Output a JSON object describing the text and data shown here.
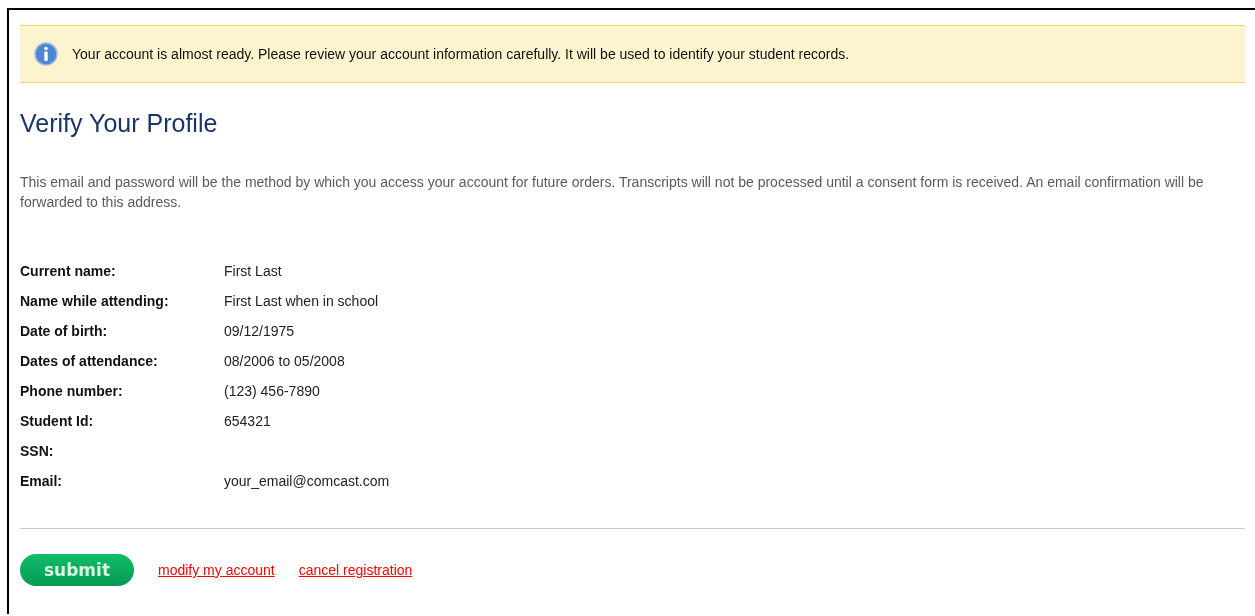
{
  "notice": {
    "text": "Your account is almost ready. Please review your account information carefully. It will be used to identify your student records."
  },
  "title": "Verify Your Profile",
  "description": "This email and password will be the method by which you access your account for future orders. Transcripts will not be processed until a consent form is received. An email confirmation will be forwarded to this address.",
  "fields": [
    {
      "label": "Current name:",
      "value": "First Last"
    },
    {
      "label": "Name while attending:",
      "value": "First Last when in school"
    },
    {
      "label": "Date of birth:",
      "value": "09/12/1975"
    },
    {
      "label": "Dates of attendance:",
      "value": "08/2006 to 05/2008"
    },
    {
      "label": "Phone number:",
      "value": "(123) 456-7890"
    },
    {
      "label": "Student Id:",
      "value": "654321"
    },
    {
      "label": "SSN:"
    },
    {
      "label": "Email:",
      "value": "your_email@comcast.com"
    }
  ],
  "actions": {
    "submit": "submit",
    "links": [
      "modify my account",
      "cancel registration"
    ]
  }
}
